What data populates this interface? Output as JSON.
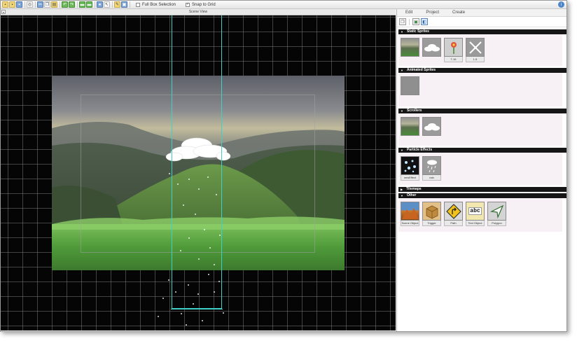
{
  "toolbar": {
    "full_box_selection_label": "Full Box Selection",
    "full_box_selection_checked": false,
    "snap_to_grid_label": "Snap to Grid",
    "snap_to_grid_checked": true,
    "icons": [
      "new-icon",
      "open-icon",
      "save-icon",
      "find-icon",
      "cut-icon",
      "copy-icon",
      "paste-icon",
      "undo-icon",
      "redo-icon",
      "folder-icon",
      "folder-icon",
      "settings-icon",
      "cursor-icon",
      "brush-icon",
      "preview-icon"
    ],
    "help_icon": "info-icon"
  },
  "scene": {
    "title": "Scene View",
    "colors": {
      "selection": "#3fd1c8",
      "grid": "#8c8c8c",
      "background": "#050505"
    }
  },
  "panel": {
    "tabs": [
      "Edit",
      "Project",
      "Create"
    ],
    "tools": [
      "copy-icon",
      "image-icon",
      "layers-icon"
    ],
    "sections": {
      "static_sprites": {
        "title": "Static Sprites",
        "items": [
          {
            "caption": "",
            "icon": "landscape-icon"
          },
          {
            "caption": "",
            "icon": "cloud-icon"
          },
          {
            "caption": "T-16",
            "icon": "flower-icon"
          },
          {
            "caption": "1-5",
            "icon": "sparkle-icon"
          }
        ]
      },
      "animated_sprites": {
        "title": "Animated Sprites",
        "items": [
          {
            "caption": "",
            "icon": "blank-sprite-icon"
          }
        ]
      },
      "scrollers": {
        "title": "Scrollers",
        "items": [
          {
            "caption": "",
            "icon": "landscape-icon"
          },
          {
            "caption": "",
            "icon": "cloud-icon"
          }
        ]
      },
      "particle_effects": {
        "title": "Particle Effects",
        "items": [
          {
            "caption": "newEffect",
            "icon": "particles-icon"
          },
          {
            "caption": "rain",
            "icon": "rain-icon"
          }
        ]
      },
      "tilemaps": {
        "title": "Tilemaps"
      },
      "other": {
        "title": "Other",
        "items": [
          {
            "caption": "Scene Object",
            "icon": "scene-object-icon"
          },
          {
            "caption": "Trigger",
            "icon": "trigger-box-icon"
          },
          {
            "caption": "Path",
            "icon": "path-sign-icon"
          },
          {
            "caption": "Text Object",
            "icon": "text-object-icon",
            "text": "abc"
          },
          {
            "caption": "Polygon",
            "icon": "polygon-icon"
          }
        ]
      }
    }
  }
}
